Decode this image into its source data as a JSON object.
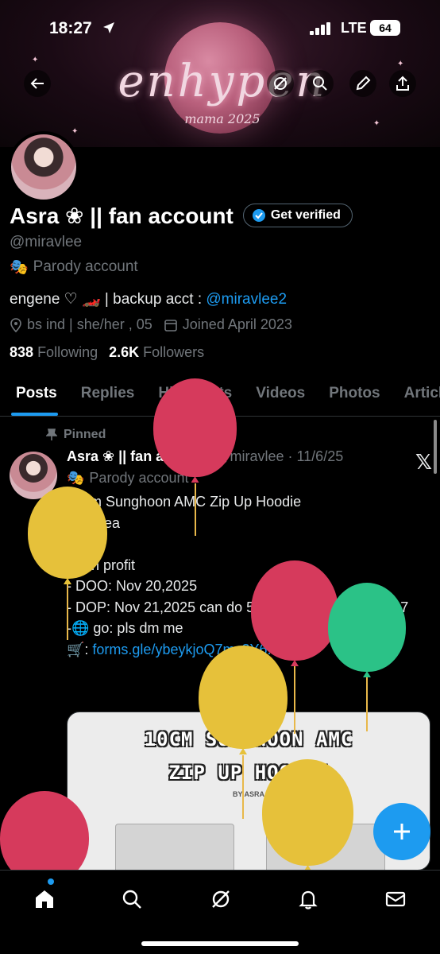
{
  "status_bar": {
    "time": "18:27",
    "network": "LTE",
    "battery": "64"
  },
  "banner": {
    "title": "enhypen",
    "subtitle": "mama 2025"
  },
  "profile": {
    "name": "Asra ❀ || fan account",
    "verify_label": "Get verified",
    "handle": "@miravlee",
    "parody_label": "Parody account",
    "bio_text": "engene ♡ 🏎️ | backup acct : ",
    "bio_link": "@miravlee2",
    "location": "bs ind | she/her , 05",
    "joined": "Joined April 2023",
    "following_count": "838",
    "following_label": "Following",
    "followers_count": "2.6K",
    "followers_label": "Followers"
  },
  "tabs": [
    {
      "label": "Posts"
    },
    {
      "label": "Replies"
    },
    {
      "label": "Highlights"
    },
    {
      "label": "Videos"
    },
    {
      "label": "Photos"
    },
    {
      "label": "Articles"
    }
  ],
  "tweet": {
    "pinned_label": "Pinned",
    "author": "Asra ❀ || fan account",
    "handle_date": "@miravlee · 11/6/25",
    "parody_label": "Parody account",
    "body": "10cm Sunghoon AMC Zip Up Hoodie\n₱ 200ea\n\n- non profit\n- DOO: Nov 20,2025\n- DOP: Nov 21,2025 can do 50% dp remibal till Nov27\n-🌐 go: pls dm me\n",
    "link_prefix": "🛒: ",
    "link": "forms.gle/ybeykjoQ7mc2Y6...",
    "media_title_1": "10CM SUNGHOON AMC",
    "media_title_2": "ZIP UP HOODIE",
    "media_by": "BY ASRA"
  },
  "colors": {
    "accent": "#1d9bf0",
    "background": "#000000",
    "muted": "#71767b"
  }
}
